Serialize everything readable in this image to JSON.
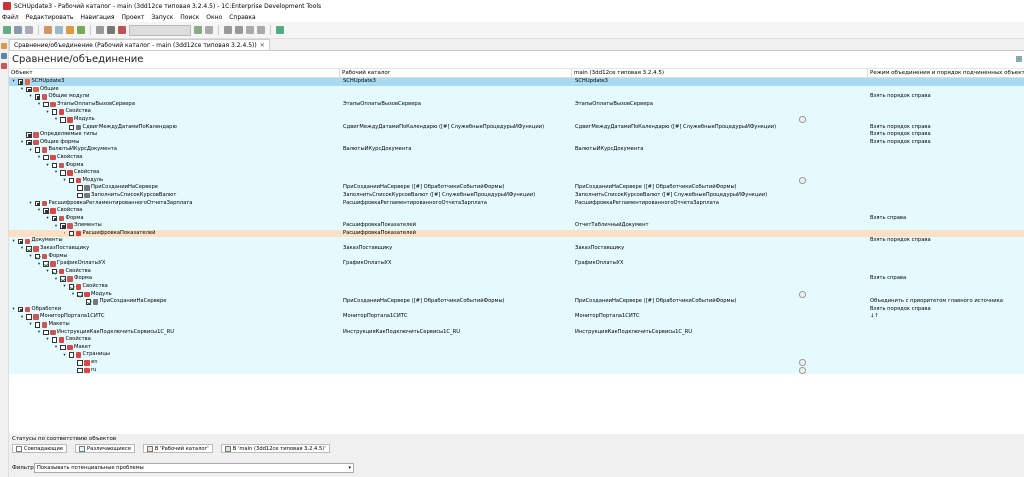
{
  "window": {
    "title": "SCHUpdate3 - Рабочий каталог - main (3dd12ce типовая 3.2.4.5) - 1C:Enterprise Development Tools"
  },
  "menu": [
    "Файл",
    "Редактировать",
    "Навигация",
    "Проект",
    "Запуск",
    "Поиск",
    "Окно",
    "Справка"
  ],
  "tab": {
    "label": "Сравнение/объединение (Рабочий каталог - main (3dd12ce типовая 3.2.4.5))"
  },
  "panel": {
    "title": "Сравнение/объединение"
  },
  "columns": [
    "Объект",
    "Рабочий каталог",
    "main (3dd12ce типовая 3.2.4.5)",
    "Режим объединения и порядок подчиненных объектов"
  ],
  "rows": [
    {
      "level": 0,
      "tw": "▾",
      "cb": "partial",
      "icon": "#d64",
      "name": "SCHUpdate3",
      "left": "SCHUpdate3",
      "right": "SCHUpdate3",
      "mode": "",
      "st": "sel"
    },
    {
      "level": 1,
      "tw": "▾",
      "cb": "partial",
      "icon": "#d64",
      "name": "Общие",
      "left": "",
      "right": "",
      "mode": ""
    },
    {
      "level": 2,
      "tw": "▾",
      "cb": "partial",
      "icon": "#c55",
      "name": "Общие модули",
      "left": "",
      "right": "",
      "mode": "Взять порядок справа"
    },
    {
      "level": 3,
      "tw": "▾",
      "cb": "",
      "icon": "#c55",
      "name": "ЭтапыОплатыВызовСервера",
      "left": "ЭтапыОплатыВызовСервера",
      "right": "ЭтапыОплатыВызовСервера",
      "mode": ""
    },
    {
      "level": 4,
      "tw": "▾",
      "cb": "",
      "icon": "#d44",
      "name": "Свойства",
      "left": "",
      "right": "",
      "mode": ""
    },
    {
      "level": 5,
      "tw": "▾",
      "cb": "",
      "icon": "#d44",
      "name": "Модуль",
      "left": "",
      "right": "",
      "mode": "",
      "gear": true
    },
    {
      "level": 6,
      "tw": "",
      "cb": "",
      "icon": "#777",
      "name": "СдвигМеждуДатамиПоКалендарю",
      "left": "СдвигМеждуДатамиПоКалендарю ([#] СлужебныеПроцедурыИФункции)",
      "right": "СдвигМеждуДатамиПоКалендарю ([#] СлужебныеПроцедурыИФункции)",
      "mode": "Взять порядок справа"
    },
    {
      "level": 1,
      "tw": "",
      "cb": "partial",
      "icon": "#c55",
      "name": "Определяемые типы",
      "left": "",
      "right": "",
      "mode": "Взять порядок справа"
    },
    {
      "level": 1,
      "tw": "▾",
      "cb": "partial",
      "icon": "#c55",
      "name": "Общие формы",
      "left": "",
      "right": "",
      "mode": "Взять порядок справа"
    },
    {
      "level": 2,
      "tw": "▾",
      "cb": "",
      "icon": "#c55",
      "name": "ВалютыИКурсДокумента",
      "left": "ВалютыИКурсДокумента",
      "right": "ВалютыИКурсДокумента",
      "mode": ""
    },
    {
      "level": 3,
      "tw": "▾",
      "cb": "",
      "icon": "#d44",
      "name": "Свойства",
      "left": "",
      "right": "",
      "mode": ""
    },
    {
      "level": 4,
      "tw": "▾",
      "cb": "",
      "icon": "#c55",
      "name": "Форма",
      "left": "",
      "right": "",
      "mode": ""
    },
    {
      "level": 5,
      "tw": "▾",
      "cb": "",
      "icon": "#d44",
      "name": "Свойства",
      "left": "",
      "right": "",
      "mode": ""
    },
    {
      "level": 6,
      "tw": "▾",
      "cb": "",
      "icon": "#d44",
      "name": "Модуль",
      "left": "",
      "right": "",
      "mode": "",
      "gear": true
    },
    {
      "level": 7,
      "tw": "",
      "cb": "",
      "icon": "#777",
      "name": "ПриСозданииНаСервере",
      "left": "ПриСозданииНаСервере ([#] ОбработчикиСобытийФормы)",
      "right": "ПриСозданииНаСервере ([#] ОбработчикиСобытийФормы)",
      "mode": ""
    },
    {
      "level": 7,
      "tw": "",
      "cb": "",
      "icon": "#777",
      "name": "ЗаполнитьСписокКурсовВалют",
      "left": "ЗаполнитьСписокКурсовВалют ([#] СлужебныеПроцедурыИФункции)",
      "right": "ЗаполнитьСписокКурсовВалют ([#] СлужебныеПроцедурыИФункции)",
      "mode": ""
    },
    {
      "level": 2,
      "tw": "▾",
      "cb": "partial",
      "icon": "#c55",
      "name": "РасшифровкаРегламентированногоОтчетаЗарплата",
      "left": "РасшифровкаРегламентированногоОтчетаЗарплата",
      "right": "РасшифровкаРегламентированногоОтчетаЗарплата",
      "mode": ""
    },
    {
      "level": 3,
      "tw": "▾",
      "cb": "partial",
      "icon": "#d44",
      "name": "Свойства",
      "left": "",
      "right": "",
      "mode": ""
    },
    {
      "level": 4,
      "tw": "▾",
      "cb": "partial",
      "icon": "#c55",
      "name": "Форма",
      "left": "",
      "right": "",
      "mode": "Взять справа"
    },
    {
      "level": 5,
      "tw": "▾",
      "cb": "partial",
      "icon": "#c55",
      "name": "Элементы",
      "left": "РасшифровкаПоказателей",
      "right": "ОтчетТабличныйДокумент",
      "mode": ""
    },
    {
      "level": 6,
      "tw": "›",
      "cb": "",
      "icon": "#d44",
      "name": "РасшифровкаПоказателей",
      "left": "РасшифровкаПоказателей",
      "right": "",
      "mode": "",
      "st": "hl"
    },
    {
      "level": 0,
      "tw": "▾",
      "cb": "partial",
      "icon": "#c55",
      "name": "Документы",
      "left": "",
      "right": "",
      "mode": "Взять порядок справа"
    },
    {
      "level": 1,
      "tw": "▾",
      "cb": "checked",
      "icon": "#c55",
      "name": "ЗаказПоставщику",
      "left": "ЗаказПоставщику",
      "right": "ЗаказПоставщику",
      "mode": ""
    },
    {
      "level": 2,
      "tw": "▾",
      "cb": "checked",
      "icon": "#c55",
      "name": "Формы",
      "left": "",
      "right": "",
      "mode": ""
    },
    {
      "level": 3,
      "tw": "▾",
      "cb": "checked",
      "icon": "#c55",
      "name": "ГрафикОплатыУХ",
      "left": "ГрафикОплатыУХ",
      "right": "ГрафикОплатыУХ",
      "mode": ""
    },
    {
      "level": 4,
      "tw": "▾",
      "cb": "checked",
      "icon": "#d44",
      "name": "Свойства",
      "left": "",
      "right": "",
      "mode": ""
    },
    {
      "level": 5,
      "tw": "▾",
      "cb": "checked",
      "icon": "#c55",
      "name": "Форма",
      "left": "",
      "right": "",
      "mode": "Взять справа"
    },
    {
      "level": 6,
      "tw": "▾",
      "cb": "checked",
      "icon": "#d44",
      "name": "Свойства",
      "left": "",
      "right": "",
      "mode": ""
    },
    {
      "level": 7,
      "tw": "▾",
      "cb": "checked",
      "icon": "#d44",
      "name": "Модуль",
      "left": "",
      "right": "",
      "mode": "",
      "gear": true
    },
    {
      "level": 8,
      "tw": "",
      "cb": "checked",
      "icon": "#777",
      "name": "ПриСозданииНаСервере",
      "left": "ПриСозданииНаСервере ([#] ОбработчикиСобытийФормы)",
      "right": "ПриСозданииНаСервере ([#] ОбработчикиСобытийФормы)",
      "mode": "Объединить с приоритетом главного источника"
    },
    {
      "level": 0,
      "tw": "▾",
      "cb": "partial",
      "icon": "#c55",
      "name": "Обработки",
      "left": "",
      "right": "",
      "mode": "Взять порядок справа"
    },
    {
      "level": 1,
      "tw": "▾",
      "cb": "",
      "icon": "#c55",
      "name": "МониторПортала1СИТС",
      "left": "МониторПортала1СИТС",
      "right": "МониторПортала1СИТС",
      "mode": "↓↑"
    },
    {
      "level": 2,
      "tw": "▾",
      "cb": "",
      "icon": "#c55",
      "name": "Макеты",
      "left": "",
      "right": "",
      "mode": ""
    },
    {
      "level": 3,
      "tw": "▾",
      "cb": "",
      "icon": "#c55",
      "name": "ИнструкцияКакПодключитьСервисы1С_RU",
      "left": "ИнструкцияКакПодключитьСервисы1С_RU",
      "right": "ИнструкцияКакПодключитьСервисы1С_RU",
      "mode": ""
    },
    {
      "level": 4,
      "tw": "▾",
      "cb": "",
      "icon": "#d44",
      "name": "Свойства",
      "left": "",
      "right": "",
      "mode": ""
    },
    {
      "level": 5,
      "tw": "▾",
      "cb": "",
      "icon": "#d44",
      "name": "Макет",
      "left": "",
      "right": "",
      "mode": ""
    },
    {
      "level": 6,
      "tw": "▾",
      "cb": "",
      "icon": "#d44",
      "name": "Страницы",
      "left": "",
      "right": "",
      "mode": ""
    },
    {
      "level": 7,
      "tw": "",
      "cb": "",
      "icon": "#d44",
      "name": "en",
      "left": "",
      "right": "",
      "mode": "",
      "gear": true
    },
    {
      "level": 7,
      "tw": "",
      "cb": "",
      "icon": "#d44",
      "name": "ru",
      "left": "",
      "right": "",
      "mode": "",
      "gear": true
    }
  ],
  "status": {
    "label": "Статусы по соответствию объектов"
  },
  "legend": [
    {
      "label": "Совпадающие",
      "color": "#ffffff"
    },
    {
      "label": "Различающиеся",
      "color": "#dff7fb"
    },
    {
      "label": "В 'Рабочий каталог'",
      "color": "#fbe0c6"
    },
    {
      "label": "В 'main (3dd12ce типовая 3.2.4.5)'",
      "color": "#d5ecd4"
    }
  ],
  "filter": {
    "label": "Фильтр:",
    "value": "Показывать потенциальные проблемы"
  }
}
